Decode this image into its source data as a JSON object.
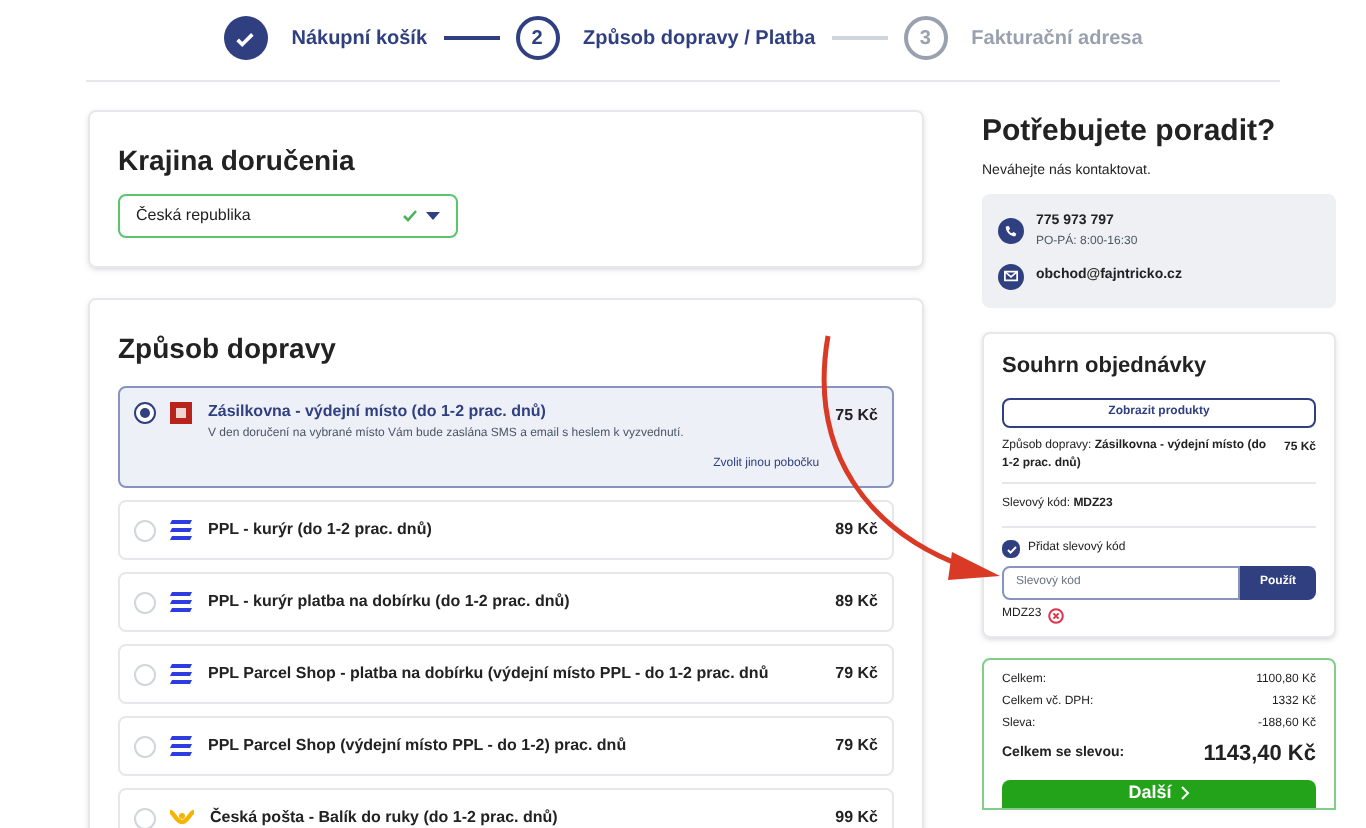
{
  "steps": [
    {
      "label": "Nákupní košík",
      "completed": true
    },
    {
      "number": "2",
      "label": "Způsob dopravy / Platba",
      "completed": false
    },
    {
      "number": "3",
      "label": "Fakturační adresa",
      "completed": false
    }
  ],
  "country": {
    "title": "Krajina doručenia",
    "value": "Česká republika",
    "valid": true
  },
  "shipping": {
    "title": "Způsob dopravy",
    "options": [
      {
        "kind": "zasilkovna",
        "name": "Zásilkovna - výdejní místo (do 1-2 prac. dnů)",
        "description": "V den doručení na vybrané místo Vám bude zaslána SMS a email s heslem k vyzvednutí.",
        "price": "75 Kč",
        "link": "Zvolit jinou pobočku",
        "selected": true
      },
      {
        "kind": "ppl",
        "name": "PPL - kurýr (do 1-2 prac. dnů)",
        "price": "89 Kč",
        "selected": false
      },
      {
        "kind": "ppl",
        "name": "PPL - kurýr platba na dobírku (do 1-2 prac. dnů)",
        "price": "89 Kč",
        "selected": false
      },
      {
        "kind": "ppl",
        "name": "PPL Parcel Shop - platba na dobírku (výdejní místo PPL - do 1-2 prac. dnů",
        "price": "79 Kč",
        "selected": false
      },
      {
        "kind": "ppl",
        "name": "PPL Parcel Shop (výdejní místo PPL - do 1-2) prac. dnů",
        "price": "79 Kč",
        "selected": false
      },
      {
        "kind": "posta",
        "name": "Česká pošta - Balík do ruky (do 1-2 prac. dnů)",
        "price": "99 Kč",
        "selected": false
      }
    ]
  },
  "help": {
    "title": "Potřebujete poradit?",
    "subtitle": "Neváhejte nás kontaktovat.",
    "phone": "775 973 797",
    "hours": "PO-PÁ: 8:00-16:30",
    "email": "obchod@fajntricko.cz"
  },
  "summary": {
    "title": "Souhrn objednávky",
    "show_products": "Zobrazit produkty",
    "shipping_line": "Způsob dopravy: **Zásilkovna - výdejní místo (do 1-2 prac. dnů)**",
    "shipping_price": "75 Kč",
    "discount_line": "Slevový kód: **MDZ23**",
    "add_discount": {
      "label": "Přidat slevový kód",
      "checked": true
    },
    "code_placeholder": "Slevový kód",
    "apply": "Použít",
    "applied_code": "MDZ23"
  },
  "totals": {
    "rows": [
      {
        "label": "Celkem:",
        "value": "1100,80 Kč"
      },
      {
        "label": "Celkem vč. DPH:",
        "value": "1332 Kč"
      },
      {
        "label": "Sleva:",
        "value": "-188,60 Kč"
      }
    ],
    "final_label": "Celkem se slevou:",
    "final_value": "1143,40 Kč",
    "next": "Další"
  }
}
